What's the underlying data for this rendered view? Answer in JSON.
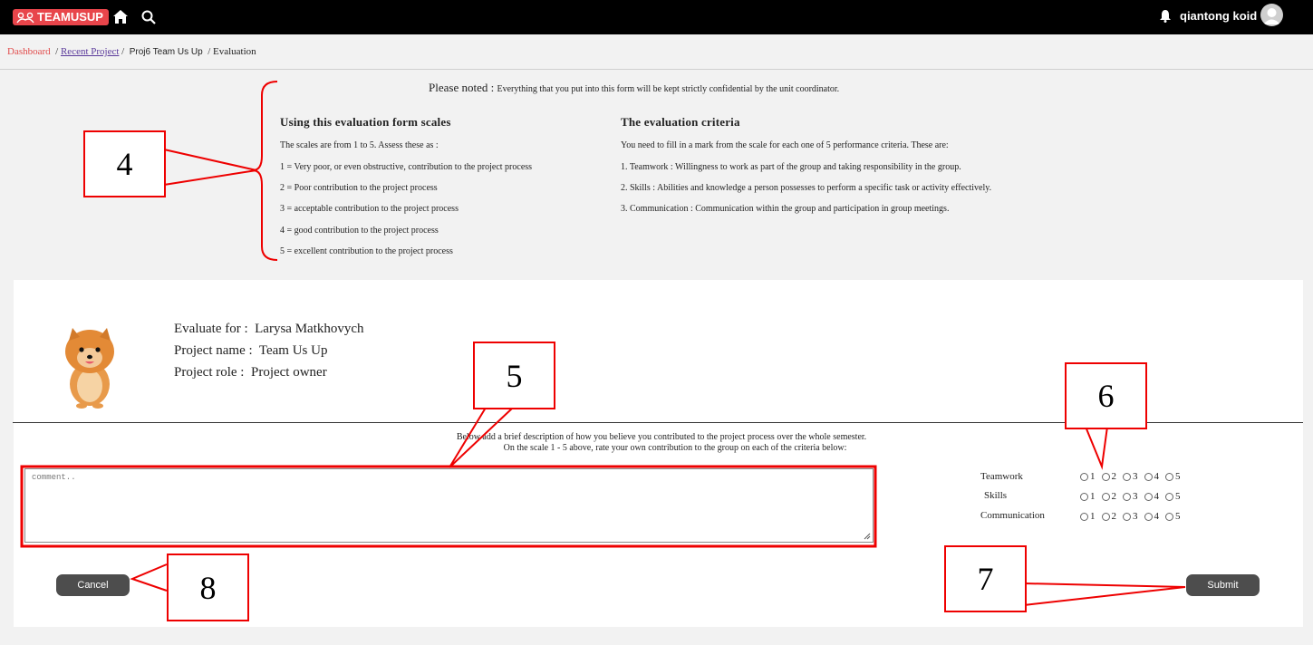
{
  "topbar": {
    "brand": "TEAMUSUP",
    "user_name": "qiantong koid"
  },
  "breadcrumb": {
    "dashboard": "Dashboard",
    "sep1": "/",
    "recent": "Recent Project",
    "sep2": "/",
    "project": "Proj6 Team Us Up",
    "sep3": "/",
    "current": "Evaluation"
  },
  "notice": {
    "label": "Please noted :",
    "text": "Everything that you put into this form will be kept strictly confidential by the unit coordinator."
  },
  "scales": {
    "title": "Using this evaluation form scales",
    "intro": "The scales are from 1 to 5. Assess these as :",
    "items": [
      "1 = Very poor, or even obstructive, contribution to the project process",
      "2 = Poor contribution to the project process",
      "3 = acceptable contribution to the project process",
      "4 = good contribution to the project process",
      "5 = excellent contribution to the project process"
    ]
  },
  "criteria": {
    "title": "The evaluation criteria",
    "intro": "You need to fill in a mark from the scale for each one of 5 performance criteria. These are:",
    "items": [
      "1. Teamwork : Willingness to work as part of the group and taking responsibility in the group.",
      "2. Skills : Abilities and knowledge a person possesses to perform a specific task or activity effectively.",
      "3. Communication : Communication within the group and participation in group meetings."
    ]
  },
  "evaluatee": {
    "evaluate_for_label": "Evaluate for :",
    "evaluate_for_value": "Larysa Matkhovych",
    "project_name_label": "Project name :",
    "project_name_value": "Team Us Up",
    "project_role_label": "Project role :",
    "project_role_value": "Project owner"
  },
  "instructions": {
    "line1": "Below add a brief description of how you believe you contributed to the project process over the whole semester.",
    "line2": "On the scale 1 - 5 above, rate your own contribution to the group on each of the criteria below:"
  },
  "comment": {
    "placeholder": "comment.."
  },
  "ratings": {
    "options": [
      "1",
      "2",
      "3",
      "4",
      "5"
    ],
    "rows": [
      {
        "label": "Teamwork"
      },
      {
        "label": "Skills"
      },
      {
        "label": "Communication"
      }
    ]
  },
  "buttons": {
    "cancel": "Cancel",
    "submit": "Submit"
  },
  "callouts": {
    "c4": "4",
    "c5": "5",
    "c6": "6",
    "c7": "7",
    "c8": "8"
  },
  "colors": {
    "brand": "#e8454b",
    "callout_border": "#ee0000",
    "button": "#4d4d4d"
  }
}
